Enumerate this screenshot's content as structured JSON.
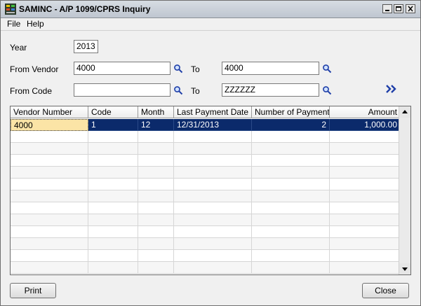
{
  "window": {
    "title": "SAMINC - A/P 1099/CPRS Inquiry"
  },
  "menu": {
    "file": "File",
    "help": "Help"
  },
  "form": {
    "year_label": "Year",
    "year_value": "2013",
    "from_vendor_label": "From Vendor",
    "from_vendor_value": "4000",
    "to_label": "To",
    "to_vendor_value": "4000",
    "from_code_label": "From Code",
    "from_code_value": "",
    "to_code_value": "ZZZZZZ"
  },
  "grid": {
    "columns": [
      "Vendor Number",
      "Code",
      "Month",
      "Last Payment Date",
      "Number of Payments",
      "Amount"
    ],
    "rows": [
      [
        "4000",
        "1",
        "12",
        "12/31/2013",
        "2",
        "1,000.00"
      ]
    ]
  },
  "buttons": {
    "print": "Print",
    "close": "Close"
  },
  "colors": {
    "selected_row": "#0b2a6b",
    "selected_cell": "#fbe4a6",
    "accent": "#1f3fa8"
  }
}
